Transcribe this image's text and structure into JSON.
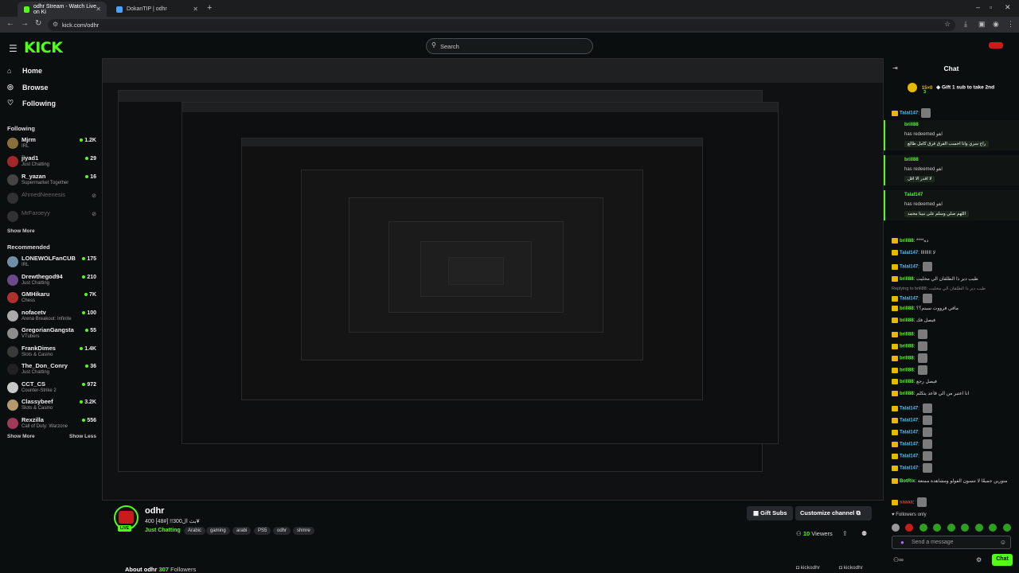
{
  "browser": {
    "tabs": [
      {
        "label": "odhr Stream - Watch Live on Ki",
        "active": true
      },
      {
        "label": "DokanTIP | odhr",
        "active": false
      }
    ],
    "url": "kick.com/odhr"
  },
  "header": {
    "logo": "KICK",
    "search_placeholder": "Search"
  },
  "sidebar": {
    "nav": [
      {
        "label": "Home",
        "icon": "home-icon"
      },
      {
        "label": "Browse",
        "icon": "compass-icon"
      },
      {
        "label": "Following",
        "icon": "heart-icon"
      }
    ],
    "following_title": "Following",
    "following": [
      {
        "name": "Mjrm",
        "category": "IRL",
        "viewers": "1.2K",
        "color": "#8a6f3a",
        "online": true
      },
      {
        "name": "jiyad1",
        "category": "Just Chatting",
        "viewers": "29",
        "color": "#a0282b",
        "online": true
      },
      {
        "name": "R_yazan",
        "category": "Supermarket Together",
        "viewers": "16",
        "color": "#444",
        "online": true
      },
      {
        "name": "AhmedNeenesis",
        "category": "",
        "viewers": "",
        "color": "#666",
        "online": false
      },
      {
        "name": "MrFaroeyy",
        "category": "",
        "viewers": "",
        "color": "#666",
        "online": false
      }
    ],
    "show_more_following": "Show More",
    "recommended_title": "Recommended",
    "recommended": [
      {
        "name": "LONEWOLFanCUB",
        "category": "IRL",
        "viewers": "175",
        "color": "#6f8fa8"
      },
      {
        "name": "Drewthegod94",
        "category": "Just Chatting",
        "viewers": "210",
        "color": "#6a4a8a"
      },
      {
        "name": "GMHikaru",
        "category": "Chess",
        "viewers": "7K",
        "color": "#b03030"
      },
      {
        "name": "nofacetv",
        "category": "Arena Breakout: Infinite",
        "viewers": "100",
        "color": "#aaa"
      },
      {
        "name": "GregorianGangsta",
        "category": "VTubers",
        "viewers": "55",
        "color": "#8d8d8d"
      },
      {
        "name": "FrankDimes",
        "category": "Slots & Casino",
        "viewers": "1.4K",
        "color": "#3a3a3a"
      },
      {
        "name": "The_Don_Conry",
        "category": "Just Chatting",
        "viewers": "36",
        "color": "#202020"
      },
      {
        "name": "CCT_CS",
        "category": "Counter-Strike 2",
        "viewers": "972",
        "color": "#c8c8c8"
      },
      {
        "name": "Classybeef",
        "category": "Slots & Casino",
        "viewers": "3.2K",
        "color": "#b69a6e"
      },
      {
        "name": "Rexzilla",
        "category": "Call of Duty: Warzone",
        "viewers": "556",
        "color": "#a03a5a"
      }
    ],
    "show_more": "Show More",
    "show_less": "Show Less"
  },
  "stream": {
    "streamer": "odhr",
    "title": "بث ال300!! [#48] 400¥",
    "category": "Just Chatting",
    "tags": [
      "Arabic",
      "gaming",
      "arabi",
      "PS5",
      "odhr",
      "shmre"
    ],
    "live_label": "LIVE",
    "gift_subs": "Gift Subs",
    "customize": "Customize channel",
    "viewers_count": "10",
    "viewers_label": "Viewers",
    "about_label": "About odhr",
    "followers_count": "307",
    "followers_label": "Followers",
    "socials": [
      "kickodhr",
      "kickodhr"
    ]
  },
  "chat": {
    "title": "Chat",
    "pinned_count": "15×0",
    "pinned_sub": "3",
    "pinned_text": "Gift 1 sub to take 2nd",
    "redeems": [
      {
        "user": "brill88",
        "action": "has redeemed",
        "reward": "اهو",
        "message": "راح سري وانا احسب الفرق فرق كامل طالع"
      },
      {
        "user": "brill88",
        "action": "has redeemed",
        "reward": "اهو",
        "message": "لا اقدر الا اقل"
      },
      {
        "user": "Talal147",
        "action": "has redeemed",
        "reward": "اهو",
        "message": "اللهم صلي وسلم على نبينا محمد"
      }
    ],
    "top_message": {
      "user": "Talal147",
      "text": ""
    },
    "messages": [
      {
        "user": "brill88",
        "text": "****ده",
        "color": "#53fc18"
      },
      {
        "user": "Talal147",
        "text": "لا اااااااا",
        "color": "#4fc3f7"
      },
      {
        "user": "Talal147",
        "text": "",
        "color": "#4fc3f7",
        "emote": true
      },
      {
        "user": "brill88",
        "text": "طيب ديز ذا الطلقان الي مخليت",
        "color": "#53fc18"
      },
      {
        "user": "Talal147",
        "text": "",
        "color": "#4fc3f7",
        "emote": true
      },
      {
        "user": "brill88",
        "text": "مافي فرووت سيتم؟؟",
        "color": "#53fc18"
      },
      {
        "user": "brill88",
        "text": "فيصل فك",
        "color": "#53fc18"
      },
      {
        "user": "brill88",
        "text": "",
        "color": "#53fc18",
        "emote": true
      },
      {
        "user": "brill88",
        "text": "",
        "color": "#53fc18",
        "emote": true
      },
      {
        "user": "brill88",
        "text": "",
        "color": "#53fc18",
        "emote": true
      },
      {
        "user": "brill88",
        "text": "",
        "color": "#53fc18",
        "emote": true
      },
      {
        "user": "brill88",
        "text": "فيصل رجع",
        "color": "#53fc18"
      },
      {
        "user": "brill88",
        "text": "انا اعتبر من الي قاعد يتكلم",
        "color": "#53fc18"
      },
      {
        "user": "Talal147",
        "text": "",
        "color": "#4fc3f7",
        "emote": true
      },
      {
        "user": "Talal147",
        "text": "",
        "color": "#4fc3f7",
        "emote": true
      },
      {
        "user": "Talal147",
        "text": "",
        "color": "#4fc3f7",
        "emote": true
      },
      {
        "user": "Talal147",
        "text": "",
        "color": "#4fc3f7",
        "emote": true
      },
      {
        "user": "Talal147",
        "text": "",
        "color": "#4fc3f7",
        "emote": true
      },
      {
        "user": "Talal147",
        "text": "",
        "color": "#4fc3f7",
        "emote": true
      },
      {
        "user": "BotRix",
        "text": "متورين جميعًا لا تنسون الفولو ومشاهدة ممتعة",
        "color": "#53fc18"
      },
      {
        "user": "saaaa",
        "text": "",
        "color": "#e53935",
        "emote": true
      }
    ],
    "replying_text": "Replying to brill88: طيب ديز ذا الطلقان الي مخليت",
    "followers_only": "Followers only",
    "input_placeholder": "Send a message",
    "send_label": "Chat"
  },
  "colors": {
    "accent": "#53fc18",
    "bg": "#0b0e0f",
    "brand_red": "#c81c1c"
  }
}
